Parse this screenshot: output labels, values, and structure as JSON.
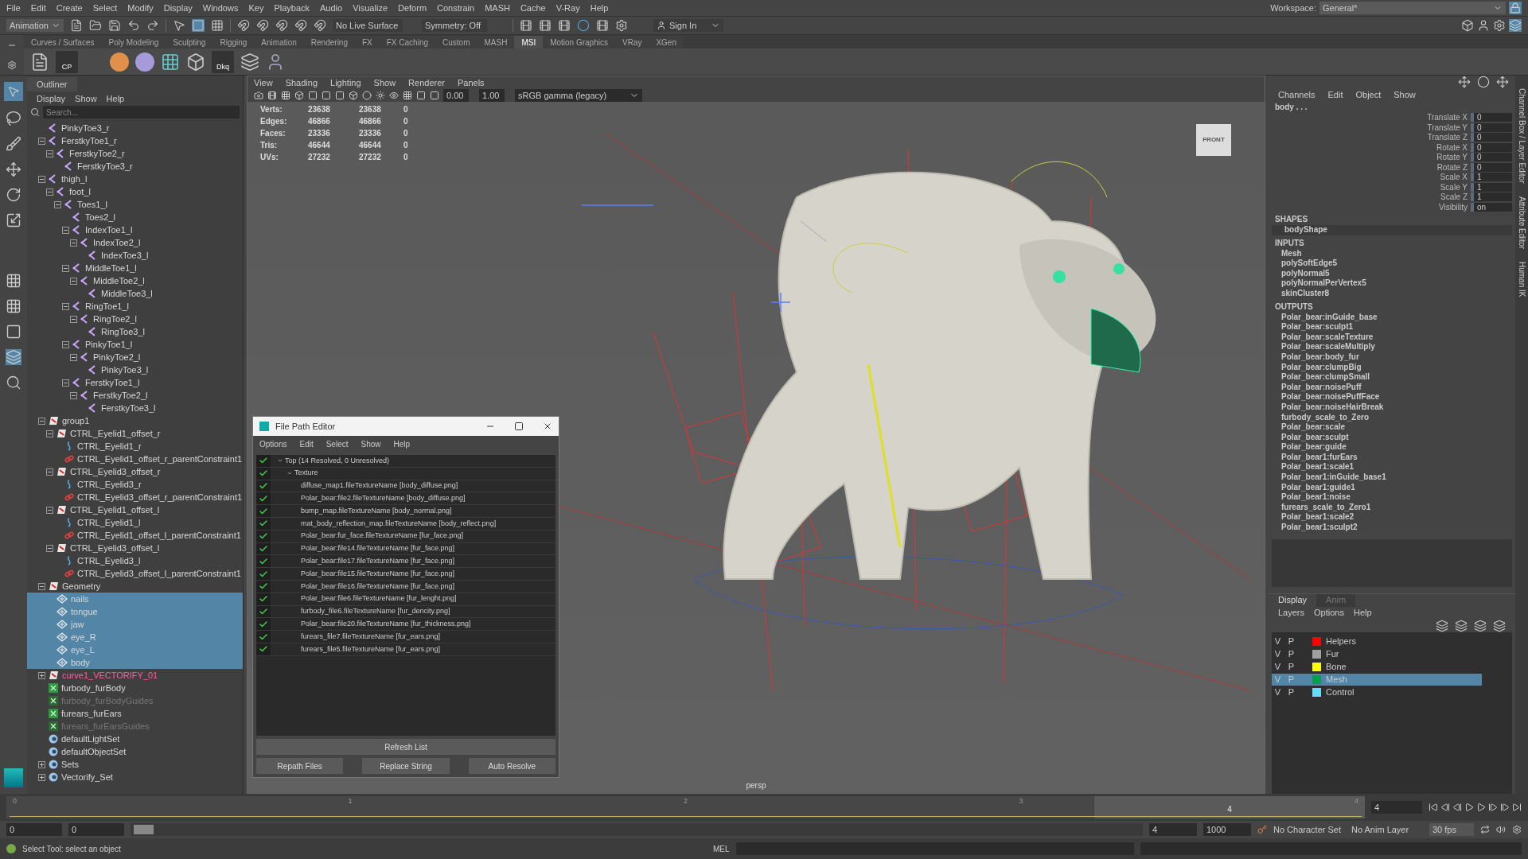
{
  "menu_bar": [
    "File",
    "Edit",
    "Create",
    "Select",
    "Modify",
    "Display",
    "Windows",
    "Key",
    "Playback",
    "Audio",
    "Visualize",
    "Deform",
    "Constrain",
    "MASH",
    "Cache",
    "V-Ray",
    "Help"
  ],
  "workspace": {
    "label": "Workspace:",
    "value": "General*"
  },
  "status_line": {
    "mode": "Animation",
    "live_surface": "No Live Surface",
    "symmetry": "Symmetry: Off",
    "sign_in": "Sign In"
  },
  "shelf_tabs": [
    {
      "label": "Curves / Surfaces",
      "selected": false
    },
    {
      "label": "Poly Modeling",
      "selected": false
    },
    {
      "label": "Sculpting",
      "selected": false
    },
    {
      "label": "Rigging",
      "selected": false
    },
    {
      "label": "Animation",
      "selected": false
    },
    {
      "label": "Rendering",
      "selected": false
    },
    {
      "label": "FX",
      "selected": false
    },
    {
      "label": "FX Caching",
      "selected": false
    },
    {
      "label": "Custom",
      "selected": false
    },
    {
      "label": "MASH",
      "selected": false
    },
    {
      "label": "MSI",
      "selected": true
    },
    {
      "label": "Motion Graphics",
      "selected": false
    },
    {
      "label": "VRay",
      "selected": false
    },
    {
      "label": "XGen",
      "selected": false
    }
  ],
  "shelf_icon_labels": [
    "CP",
    "Dkq"
  ],
  "outliner": {
    "title": "Outliner",
    "menu": [
      "Display",
      "Show",
      "Help"
    ],
    "search": {
      "placeholder": "Search..."
    },
    "rows": [
      {
        "name": "PinkyToe3_r",
        "kind": "joint",
        "selected": false
      },
      {
        "name": "FerstkyToe1_r",
        "kind": "joint",
        "expanded": true,
        "selected": false,
        "children": [
          {
            "name": "FerstkyToe2_r",
            "kind": "joint",
            "expanded": true,
            "selected": false,
            "children": [
              {
                "name": "FerstkyToe3_r",
                "kind": "joint",
                "selected": false
              }
            ]
          }
        ]
      },
      {
        "name": "thigh_l",
        "kind": "joint",
        "expanded": true,
        "selected": false,
        "children": [
          {
            "name": "foot_l",
            "kind": "joint",
            "expanded": true,
            "selected": false,
            "children": [
              {
                "name": "Toes1_l",
                "kind": "joint",
                "expanded": true,
                "selected": false,
                "children": [
                  {
                    "name": "Toes2_l",
                    "kind": "joint",
                    "selected": false
                  },
                  {
                    "name": "IndexToe1_l",
                    "kind": "joint",
                    "expanded": true,
                    "selected": false,
                    "children": [
                      {
                        "name": "IndexToe2_l",
                        "kind": "joint",
                        "expanded": true,
                        "selected": false,
                        "children": [
                          {
                            "name": "IndexToe3_l",
                            "kind": "joint",
                            "selected": false
                          }
                        ]
                      }
                    ]
                  },
                  {
                    "name": "MiddleToe1_l",
                    "kind": "joint",
                    "expanded": true,
                    "selected": false,
                    "children": [
                      {
                        "name": "MiddleToe2_l",
                        "kind": "joint",
                        "expanded": true,
                        "selected": false,
                        "children": [
                          {
                            "name": "MiddleToe3_l",
                            "kind": "joint",
                            "selected": false
                          }
                        ]
                      }
                    ]
                  },
                  {
                    "name": "RingToe1_l",
                    "kind": "joint",
                    "expanded": true,
                    "selected": false,
                    "children": [
                      {
                        "name": "RingToe2_l",
                        "kind": "joint",
                        "expanded": true,
                        "selected": false,
                        "children": [
                          {
                            "name": "RingToe3_l",
                            "kind": "joint",
                            "selected": false
                          }
                        ]
                      }
                    ]
                  },
                  {
                    "name": "PinkyToe1_l",
                    "kind": "joint",
                    "expanded": true,
                    "selected": false,
                    "children": [
                      {
                        "name": "PinkyToe2_l",
                        "kind": "joint",
                        "expanded": true,
                        "selected": false,
                        "children": [
                          {
                            "name": "PinkyToe3_l",
                            "kind": "joint",
                            "selected": false
                          }
                        ]
                      }
                    ]
                  },
                  {
                    "name": "FerstkyToe1_l",
                    "kind": "joint",
                    "expanded": true,
                    "selected": false,
                    "children": [
                      {
                        "name": "FerstkyToe2_l",
                        "kind": "joint",
                        "expanded": true,
                        "selected": false,
                        "children": [
                          {
                            "name": "FerstkyToe3_l",
                            "kind": "joint",
                            "selected": false
                          }
                        ]
                      }
                    ]
                  }
                ]
              }
            ]
          }
        ]
      },
      {
        "name": "group1",
        "kind": "group",
        "expanded": true,
        "selected": false,
        "children": [
          {
            "name": "CTRL_Eyelid1_offset_r",
            "kind": "group",
            "expanded": true,
            "selected": false,
            "children": [
              {
                "name": "CTRL_Eyelid1_r",
                "kind": "curve",
                "selected": false
              },
              {
                "name": "CTRL_Eyelid1_offset_r_parentConstraint1",
                "kind": "constraint",
                "selected": false
              }
            ]
          },
          {
            "name": "CTRL_Eyelid3_offset_r",
            "kind": "group",
            "expanded": true,
            "selected": false,
            "children": [
              {
                "name": "CTRL_Eyelid3_r",
                "kind": "curve",
                "selected": false
              },
              {
                "name": "CTRL_Eyelid3_offset_r_parentConstraint1",
                "kind": "constraint",
                "selected": false
              }
            ]
          },
          {
            "name": "CTRL_Eyelid1_offset_l",
            "kind": "group",
            "expanded": true,
            "selected": false,
            "children": [
              {
                "name": "CTRL_Eyelid1_l",
                "kind": "curve",
                "selected": false
              },
              {
                "name": "CTRL_Eyelid1_offset_l_parentConstraint1",
                "kind": "constraint",
                "selected": false
              }
            ]
          },
          {
            "name": "CTRL_Eyelid3_offset_l",
            "kind": "group",
            "expanded": true,
            "selected": false,
            "children": [
              {
                "name": "CTRL_Eyelid3_l",
                "kind": "curve",
                "selected": false
              },
              {
                "name": "CTRL_Eyelid3_offset_l_parentConstraint1",
                "kind": "constraint",
                "selected": false
              }
            ]
          }
        ]
      },
      {
        "name": "Geometry",
        "kind": "group",
        "expanded": true,
        "selected": false,
        "children": [
          {
            "name": "nails",
            "kind": "mesh",
            "selected": true
          },
          {
            "name": "tongue",
            "kind": "mesh",
            "selected": true
          },
          {
            "name": "jaw",
            "kind": "mesh",
            "selected": true
          },
          {
            "name": "eye_R",
            "kind": "mesh",
            "selected": true
          },
          {
            "name": "eye_L",
            "kind": "mesh",
            "selected": true
          },
          {
            "name": "body",
            "kind": "mesh",
            "selected": true
          }
        ]
      },
      {
        "name": "curve1_VECTORIFY_01",
        "kind": "vector_curve",
        "expanded": false,
        "selected": false
      },
      {
        "name": "furbody_furBody",
        "kind": "fur",
        "selected": false
      },
      {
        "name": "furbody_furBodyGuides",
        "kind": "fur_guide",
        "selected": false
      },
      {
        "name": "furears_furEars",
        "kind": "fur",
        "selected": false
      },
      {
        "name": "furears_furEarsGuides",
        "kind": "fur_guide",
        "selected": false
      },
      {
        "name": "defaultLightSet",
        "kind": "set",
        "selected": false
      },
      {
        "name": "defaultObjectSet",
        "kind": "set",
        "selected": false
      },
      {
        "name": "Sets",
        "kind": "set",
        "expanded": false,
        "selected": false
      },
      {
        "name": "Vectorify_Set",
        "kind": "set",
        "expanded": false,
        "selected": false
      }
    ]
  },
  "viewport": {
    "menu": [
      "View",
      "Shading",
      "Lighting",
      "Show",
      "Renderer",
      "Panels"
    ],
    "exposure": "0.00",
    "gamma": "1.00",
    "color_space": "sRGB gamma (legacy)",
    "hud": [
      {
        "label": "Verts:",
        "values": [
          "23638",
          "23638",
          "0"
        ]
      },
      {
        "label": "Edges:",
        "values": [
          "46866",
          "46866",
          "0"
        ]
      },
      {
        "label": "Faces:",
        "values": [
          "23336",
          "23336",
          "0"
        ]
      },
      {
        "label": "Tris:",
        "values": [
          "46644",
          "46644",
          "0"
        ]
      },
      {
        "label": "UVs:",
        "values": [
          "27232",
          "27232",
          "0"
        ]
      }
    ],
    "view_cube": "FRONT",
    "camera": "persp"
  },
  "file_path_editor": {
    "title": "File Path Editor",
    "menu": [
      "Options",
      "Edit",
      "Select",
      "Show",
      "Help"
    ],
    "rows": [
      {
        "text": "Top (14 Resolved, 0 Unresolved)",
        "kind": "root",
        "resolved": true
      },
      {
        "text": "Texture",
        "kind": "folder",
        "resolved": true
      },
      {
        "text": "diffuse_map1.fileTextureName [body_diffuse.png]",
        "kind": "file",
        "resolved": true
      },
      {
        "text": "Polar_bear:file2.fileTextureName [body_diffuse.png]",
        "kind": "file",
        "resolved": true
      },
      {
        "text": "bump_map.fileTextureName [body_normal.png]",
        "kind": "file",
        "resolved": true
      },
      {
        "text": "mat_body_reflection_map.fileTextureName [body_reflect.png]",
        "kind": "file",
        "resolved": true
      },
      {
        "text": "Polar_bear:fur_face.fileTextureName [fur_face.png]",
        "kind": "file",
        "resolved": true
      },
      {
        "text": "Polar_bear:file14.fileTextureName [fur_face.png]",
        "kind": "file",
        "resolved": true
      },
      {
        "text": "Polar_bear:file17.fileTextureName [fur_face.png]",
        "kind": "file",
        "resolved": true
      },
      {
        "text": "Polar_bear:file15.fileTextureName [fur_face.png]",
        "kind": "file",
        "resolved": true
      },
      {
        "text": "Polar_bear:file16.fileTextureName [fur_face.png]",
        "kind": "file",
        "resolved": true
      },
      {
        "text": "Polar_bear:file6.fileTextureName [fur_lenght.png]",
        "kind": "file",
        "resolved": true
      },
      {
        "text": "furbody_file6.fileTextureName [fur_dencity.png]",
        "kind": "file",
        "resolved": true
      },
      {
        "text": "Polar_bear:file20.fileTextureName [fur_thickness.png]",
        "kind": "file",
        "resolved": true
      },
      {
        "text": "furears_file7.fileTextureName [fur_ears.png]",
        "kind": "file",
        "resolved": true
      },
      {
        "text": "furears_file5.fileTextureName [fur_ears.png]",
        "kind": "file",
        "resolved": true
      }
    ],
    "refresh": "Refresh List",
    "buttons": [
      "Repath Files",
      "Replace String",
      "Auto Resolve"
    ]
  },
  "channel_box": {
    "menu": [
      "Channels",
      "Edit",
      "Object",
      "Show"
    ],
    "object": "body . . .",
    "attributes": [
      {
        "name": "Translate X",
        "value": "0"
      },
      {
        "name": "Translate Y",
        "value": "0"
      },
      {
        "name": "Translate Z",
        "value": "0"
      },
      {
        "name": "Rotate X",
        "value": "0"
      },
      {
        "name": "Rotate Y",
        "value": "0"
      },
      {
        "name": "Rotate Z",
        "value": "0"
      },
      {
        "name": "Scale X",
        "value": "1"
      },
      {
        "name": "Scale Y",
        "value": "1"
      },
      {
        "name": "Scale Z",
        "value": "1"
      },
      {
        "name": "Visibility",
        "value": "on"
      }
    ],
    "shapes_heading": "SHAPES",
    "shapes": [
      "bodyShape"
    ],
    "inputs_heading": "INPUTS",
    "inputs": [
      "Mesh",
      "polySoftEdge5",
      "polyNormal5",
      "polyNormalPerVertex5",
      "skinCluster8"
    ],
    "outputs_heading": "OUTPUTS",
    "outputs": [
      "Polar_bear:inGuide_base",
      "Polar_bear:sculpt1",
      "Polar_bear:scaleTexture",
      "Polar_bear:scaleMultiply",
      "Polar_bear:body_fur",
      "Polar_bear:clumpBig",
      "Polar_bear:clumpSmall",
      "Polar_bear:noisePuff",
      "Polar_bear:noisePuffFace",
      "Polar_bear:noiseHairBreak",
      "furbody_scale_to_Zero",
      "Polar_bear:scale",
      "Polar_bear:sculpt",
      "Polar_bear:guide",
      "Polar_bear1:furEars",
      "Polar_bear1:scale1",
      "Polar_bear1:inGuide_base1",
      "Polar_bear1:guide1",
      "Polar_bear1:noise",
      "furears_scale_to_Zero1",
      "Polar_bear1:scale2",
      "Polar_bear1:sculpt2"
    ]
  },
  "side_tabs": [
    "Channel Box / Layer Editor",
    "Attribute Editor",
    "Human IK"
  ],
  "layer_editor": {
    "tabs": [
      {
        "label": "Display",
        "selected": true
      },
      {
        "label": "Anim",
        "selected": false
      }
    ],
    "menu": [
      "Layers",
      "Options",
      "Help"
    ],
    "layers": [
      {
        "name": "Helpers",
        "color": "#ff0000",
        "visible_label": "V",
        "playback_label": "P",
        "selected": false
      },
      {
        "name": "Fur",
        "color": "#a0a0a0",
        "visible_label": "V",
        "playback_label": "P",
        "selected": false
      },
      {
        "name": "Bone",
        "color": "#ffff00",
        "visible_label": "V",
        "playback_label": "P",
        "selected": false
      },
      {
        "name": "Mesh",
        "color": "#00a050",
        "visible_label": "V",
        "playback_label": "P",
        "selected": true
      },
      {
        "name": "Control",
        "color": "#66ddff",
        "visible_label": "V",
        "playback_label": "P",
        "selected": false
      }
    ]
  },
  "time_slider": {
    "ticks": [
      "0",
      "1",
      "2",
      "3",
      "4"
    ],
    "current_label": "4",
    "current_frame": "4",
    "level": 0.8
  },
  "range_slider": {
    "level": 0.02,
    "start": "0",
    "range_start": "0",
    "range_end": "4",
    "end": "1000",
    "character_set": "No Character Set",
    "anim_layer": "No Anim Layer",
    "fps": "30 fps"
  },
  "help_line": "Select Tool: select an object",
  "command_language": "MEL"
}
